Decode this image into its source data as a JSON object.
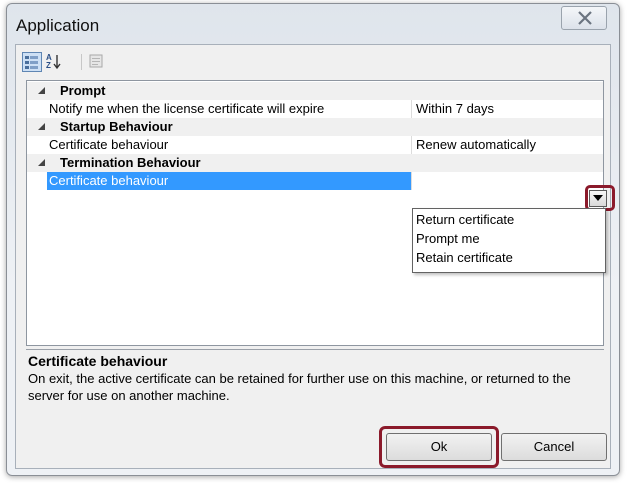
{
  "window": {
    "title": "Application",
    "close_icon": "close-icon"
  },
  "toolbar": {
    "categorized_icon": "categorized-view-icon",
    "alphabetical_icon": "alphabetical-sort-icon",
    "property_pages_icon": "property-pages-icon"
  },
  "grid": {
    "categories": [
      {
        "label": "Prompt",
        "properties": [
          {
            "name": "Notify me when the license certificate will expire",
            "value": "Within 7 days"
          }
        ]
      },
      {
        "label": "Startup Behaviour",
        "properties": [
          {
            "name": "Certificate behaviour",
            "value": "Renew automatically"
          }
        ]
      },
      {
        "label": "Termination Behaviour",
        "properties": [
          {
            "name": "Certificate behaviour",
            "value": ""
          }
        ]
      }
    ],
    "dropdown_options": [
      "Return certificate",
      "Prompt me",
      "Retain certificate"
    ]
  },
  "description": {
    "title": "Certificate behaviour",
    "text": "On exit, the active certificate can be retained for further use on this machine, or returned to the server for use on another machine."
  },
  "buttons": {
    "ok": "Ok",
    "cancel": "Cancel"
  },
  "colors": {
    "selection": "#3399ff",
    "highlight_border": "#8b1a2b"
  }
}
